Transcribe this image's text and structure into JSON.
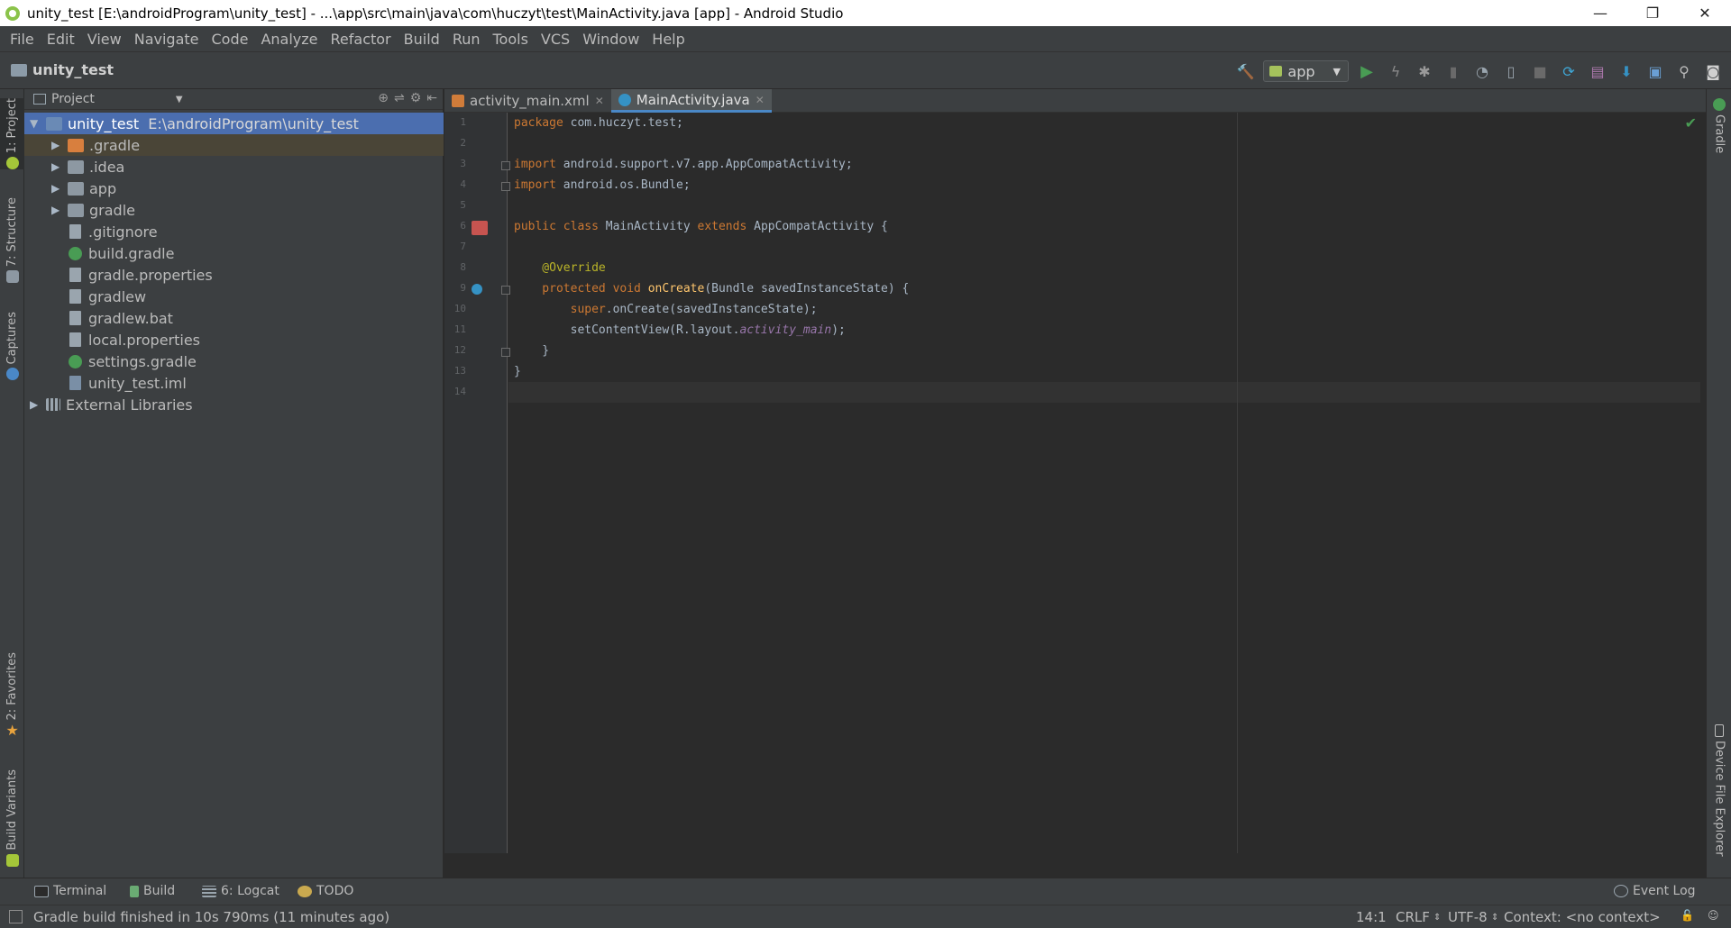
{
  "window": {
    "title": "unity_test [E:\\androidProgram\\unity_test] - ...\\app\\src\\main\\java\\com\\huczyt\\test\\MainActivity.java [app] - Android Studio",
    "minimize": "—",
    "restore": "❐",
    "close": "✕"
  },
  "menu": [
    "File",
    "Edit",
    "View",
    "Navigate",
    "Code",
    "Analyze",
    "Refactor",
    "Build",
    "Run",
    "Tools",
    "VCS",
    "Window",
    "Help"
  ],
  "navbar": {
    "project_name": "unity_test",
    "run_config": "app"
  },
  "left_strip": {
    "project": "1: Project",
    "structure": "7: Structure",
    "captures": "Captures",
    "favorites": "2: Favorites",
    "build_variants": "Build Variants"
  },
  "right_strip": {
    "gradle": "Gradle",
    "device_file_explorer": "Device File Explorer"
  },
  "project_panel": {
    "title": "Project",
    "root": {
      "name": "unity_test",
      "path": "E:\\androidProgram\\unity_test"
    },
    "items": [
      {
        "name": ".gradle"
      },
      {
        "name": ".idea"
      },
      {
        "name": "app"
      },
      {
        "name": "gradle"
      },
      {
        "name": ".gitignore"
      },
      {
        "name": "build.gradle"
      },
      {
        "name": "gradle.properties"
      },
      {
        "name": "gradlew"
      },
      {
        "name": "gradlew.bat"
      },
      {
        "name": "local.properties"
      },
      {
        "name": "settings.gradle"
      },
      {
        "name": "unity_test.iml"
      }
    ],
    "external": "External Libraries"
  },
  "tabs": [
    {
      "label": "activity_main.xml",
      "active": false
    },
    {
      "label": "MainActivity.java",
      "active": true
    }
  ],
  "editor": {
    "line_numbers": [
      "1",
      "2",
      "3",
      "4",
      "5",
      "6",
      "7",
      "8",
      "9",
      "10",
      "11",
      "12",
      "13",
      "14"
    ],
    "code": {
      "l1_kw": "package",
      "l1_rest": " com.huczyt.test;",
      "l3_kw": "import",
      "l3_rest": " android.support.v7.app.AppCompatActivity;",
      "l4_kw": "import",
      "l4_rest": " android.os.Bundle;",
      "l6_kw1": "public class",
      "l6_name": " MainActivity ",
      "l6_kw2": "extends",
      "l6_rest": " AppCompatActivity {",
      "l8_ann": "    @Override",
      "l9_kw": "    protected void",
      "l9_fn": " onCreate",
      "l9_rest": "(Bundle savedInstanceState) {",
      "l10_kw": "        super",
      "l10_rest": ".onCreate(savedInstanceState);",
      "l11_pre": "        setContentView(R.layout.",
      "l11_it": "activity_main",
      "l11_post": ");",
      "l12": "    }",
      "l13": "}"
    }
  },
  "bottom_tools": {
    "terminal": "Terminal",
    "build": "Build",
    "logcat": "6: Logcat",
    "todo": "TODO",
    "event_log": "Event Log"
  },
  "status": {
    "message": "Gradle build finished in 10s 790ms (11 minutes ago)",
    "position": "14:1",
    "line_sep": "CRLF",
    "encoding": "UTF-8",
    "context": "Context: <no context>"
  },
  "colors": {
    "selection": "#4b6eaf",
    "keyword": "#cc7832",
    "annotation": "#bbb529",
    "function": "#ffc66d",
    "run_green": "#499c54"
  }
}
